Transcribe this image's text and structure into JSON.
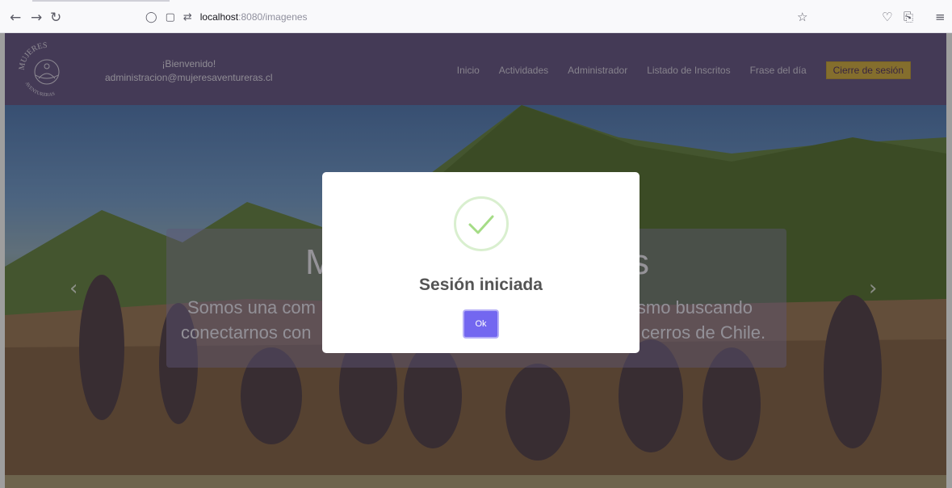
{
  "browser": {
    "url_host": "localhost",
    "url_path": ":8080/imagenes"
  },
  "header": {
    "logo_top_text": "MUJERES",
    "logo_bottom_text": "AVENTURERAS",
    "welcome_line1": "¡Bienvenido!",
    "welcome_line2": "administracion@mujeresaventureras.cl",
    "nav": [
      "Inicio",
      "Actividades",
      "Administrador",
      "Listado de Inscritos",
      "Frase del día"
    ],
    "logout_label": "Cierre de sesión"
  },
  "hero": {
    "title_left": "M",
    "title_right": "s",
    "text_line1_left": "Somos una com",
    "text_line1_right": "ismo buscando",
    "text_line2_left": "conectarnos con",
    "text_line2_right": "cerros de Chile."
  },
  "modal": {
    "title": "Sesión iniciada",
    "ok_label": "Ok",
    "icon": "check-icon"
  },
  "colors": {
    "header_bg": "#6f5e8c",
    "logout_bg": "#d6b24a",
    "ok_button": "#7367f0",
    "success_check": "#a5dc86"
  }
}
